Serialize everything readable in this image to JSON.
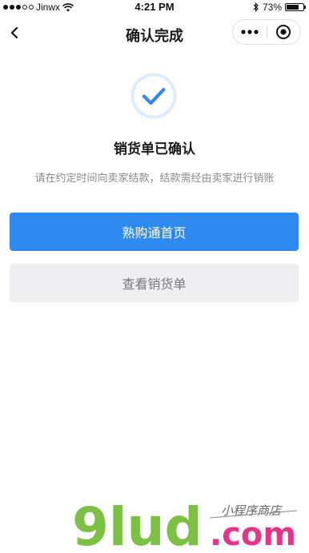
{
  "status_bar": {
    "carrier": "Jinwx",
    "time": "4:21 PM",
    "battery_percent": "73%",
    "battery_level": 0.73
  },
  "nav": {
    "title": "确认完成",
    "back_icon": "chevron-left-icon",
    "more_icon": "more-dots-icon",
    "close_icon": "record-circle-icon"
  },
  "result": {
    "icon": "check-circle-icon",
    "title": "销货单已确认",
    "description": "请在约定时间向卖家结款，结款需经由卖家进行销账"
  },
  "actions": {
    "primary_label": "熟购通首页",
    "secondary_label": "查看销货单"
  },
  "watermark": {
    "brand": "9lud",
    "domain": ".com",
    "tagline": "小程序商店"
  },
  "colors": {
    "primary": "#2f8af0",
    "secondary_bg": "#efeff2",
    "secondary_text": "#7a7a7a",
    "icon_ring": "#dcecfd",
    "watermark_green": "#7cc143",
    "watermark_pink": "#e7348b"
  }
}
